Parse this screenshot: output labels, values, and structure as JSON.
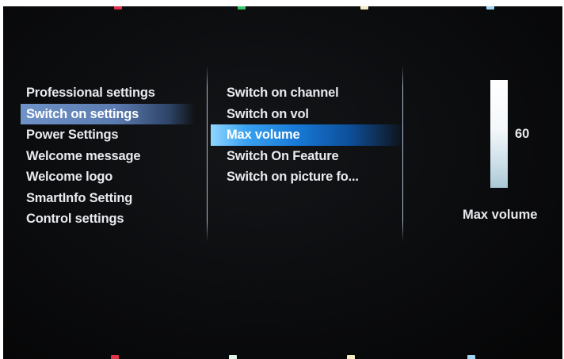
{
  "color_keys": {
    "top": [
      "#e0344a",
      "#38c96a",
      "#f4ecc2",
      "#9fd6f4"
    ],
    "bottom": [
      "#e0344a",
      "#dff5e6",
      "#f4ecc2",
      "#9fd6f4"
    ]
  },
  "settings_menu": {
    "items": [
      {
        "label": "Professional settings"
      },
      {
        "label": "Switch on settings"
      },
      {
        "label": "Power Settings"
      },
      {
        "label": "Welcome message"
      },
      {
        "label": "Welcome logo"
      },
      {
        "label": "SmartInfo Setting"
      },
      {
        "label": "Control settings"
      }
    ],
    "selected_index": 1
  },
  "switch_on_menu": {
    "items": [
      {
        "label": "Switch on channel"
      },
      {
        "label": "Switch on vol"
      },
      {
        "label": "Max volume"
      },
      {
        "label": "Switch On Feature"
      },
      {
        "label": "Switch on picture fo..."
      }
    ],
    "highlighted_index": 2
  },
  "slider": {
    "value": "60",
    "level_fraction": 1.0,
    "label": "Max volume"
  },
  "colors": {
    "selected_bg": "#5a7bb0",
    "highlight_bg": "#1778d6",
    "text": "#e8eaee"
  }
}
